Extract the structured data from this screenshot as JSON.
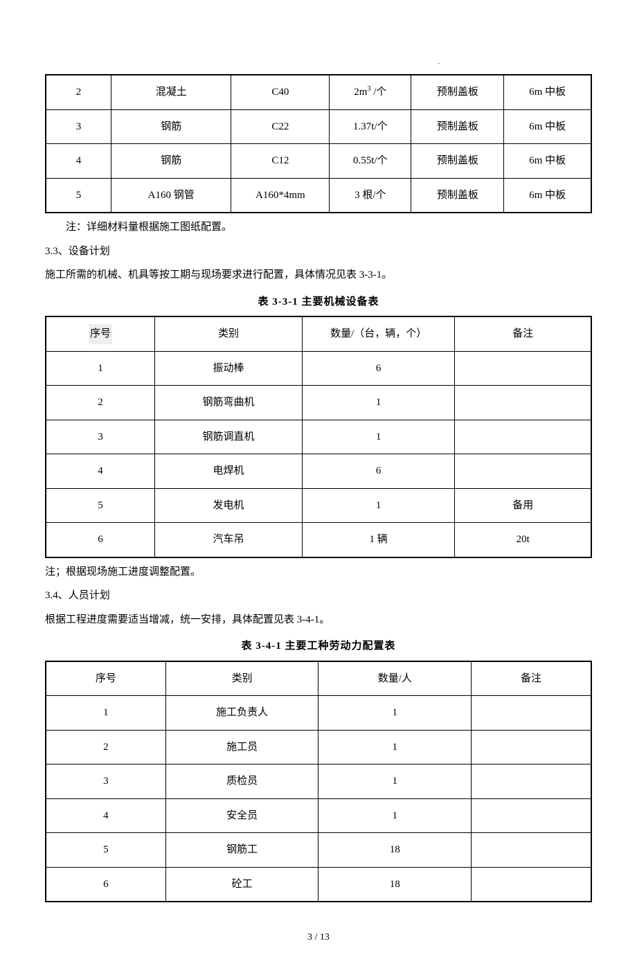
{
  "table1": {
    "rows": [
      {
        "no": "2",
        "name": "混凝土",
        "spec": "C40",
        "qty": "2m³ /个",
        "use": "预制盖板",
        "remark": "6m 中板"
      },
      {
        "no": "3",
        "name": "钢筋",
        "spec": "C22",
        "qty": "1.37t/个",
        "use": "预制盖板",
        "remark": "6m 中板"
      },
      {
        "no": "4",
        "name": "钢筋",
        "spec": "C12",
        "qty": "0.55t/个",
        "use": "预制盖板",
        "remark": "6m 中板"
      },
      {
        "no": "5",
        "name": "A160 钢管",
        "spec": "A160*4mm",
        "qty": "3 根/个",
        "use": "预制盖板",
        "remark": "6m 中板"
      }
    ],
    "note": "注：详细材料量根据施工图纸配置。"
  },
  "section33": "3.3、设备计划",
  "p33": "施工所需的机械、机具等按工期与现场要求进行配置，具体情况见表 3-3-1。",
  "table2": {
    "title": "表 3-3-1 主要机械设备表",
    "head": {
      "c1": "序号",
      "c2": "类别",
      "c3": "数量/（台，辆，个）",
      "c4": "备注"
    },
    "rows": [
      {
        "no": "1",
        "cat": "振动棒",
        "qty": "6",
        "remark": ""
      },
      {
        "no": "2",
        "cat": "钢筋弯曲机",
        "qty": "1",
        "remark": ""
      },
      {
        "no": "3",
        "cat": "钢筋调直机",
        "qty": "1",
        "remark": ""
      },
      {
        "no": "4",
        "cat": "电焊机",
        "qty": "6",
        "remark": ""
      },
      {
        "no": "5",
        "cat": "发电机",
        "qty": "1",
        "remark": "备用"
      },
      {
        "no": "6",
        "cat": "汽车吊",
        "qty": "1 辆",
        "remark": "20t"
      }
    ],
    "note": "注；根据现场施工进度调整配置。"
  },
  "section34": "3.4、人员计划",
  "p34": "根据工程进度需要适当增减，统一安排，具体配置见表 3-4-1。",
  "table3": {
    "title": "表 3-4-1 主要工种劳动力配置表",
    "head": {
      "c1": "序号",
      "c2": "类别",
      "c3": "数量/人",
      "c4": "备注"
    },
    "rows": [
      {
        "no": "1",
        "cat": "施工负责人",
        "qty": "1",
        "remark": ""
      },
      {
        "no": "2",
        "cat": "施工员",
        "qty": "1",
        "remark": ""
      },
      {
        "no": "3",
        "cat": "质检员",
        "qty": "1",
        "remark": ""
      },
      {
        "no": "4",
        "cat": "安全员",
        "qty": "1",
        "remark": ""
      },
      {
        "no": "5",
        "cat": "钢筋工",
        "qty": "18",
        "remark": ""
      },
      {
        "no": "6",
        "cat": "砼工",
        "qty": "18",
        "remark": ""
      }
    ]
  },
  "pager": "3 / 13"
}
